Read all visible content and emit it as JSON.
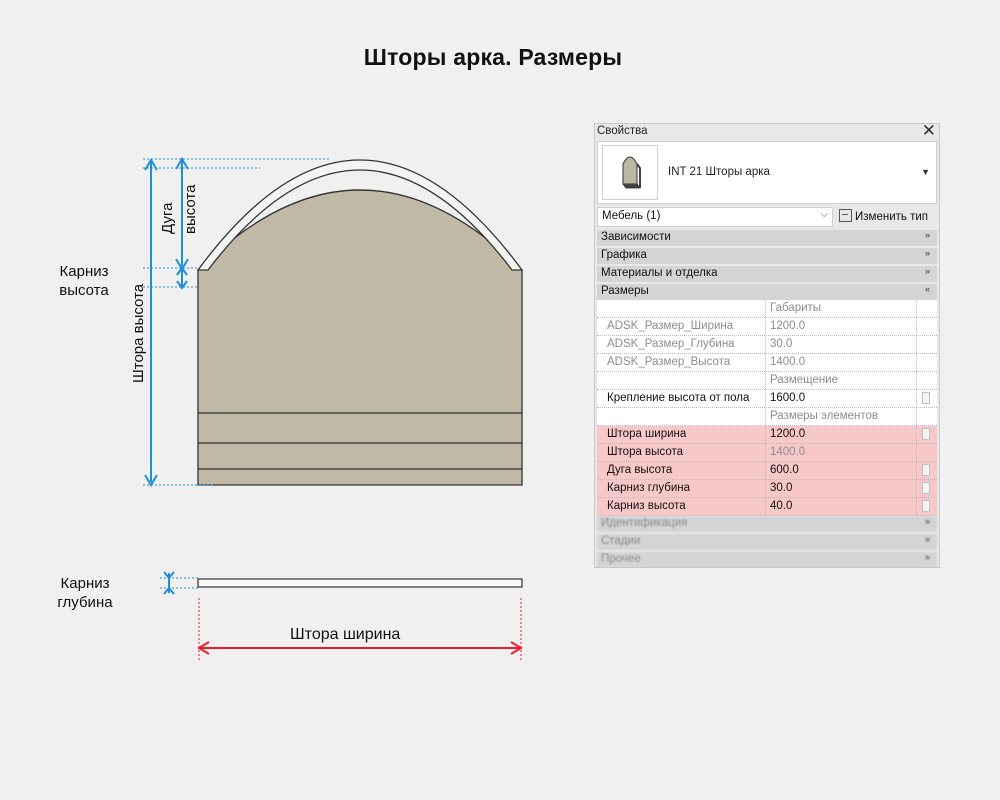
{
  "title": "Шторы арка. Размеры",
  "drawing": {
    "labels": {
      "karniz_vysota": "Карниз высота",
      "shtora_vysota": "Штора высота",
      "duga_vysota": "Дуга высота",
      "karniz_glubina": "Карниз глубина",
      "shtora_shirina": "Штора ширина"
    },
    "colors": {
      "curtain_fill": "#bfb9a6",
      "dimension_blue": "#1f8fd6",
      "dimension_red": "#e41e26",
      "outline": "#333333"
    }
  },
  "panel": {
    "title": "Свойства",
    "close_icon": "close-icon",
    "type_name": "INT 21 Шторы арка",
    "filter": "Мебель (1)",
    "edit_type": "Изменить тип",
    "categories": {
      "constraints": "Зависимости",
      "graphics": "Графика",
      "materials": "Материалы и отделка",
      "dimensions": "Размеры",
      "identity": "Идентификация",
      "phasing": "Стадии",
      "other": "Прочее"
    },
    "rows": [
      {
        "name": "",
        "value": "Габариты"
      },
      {
        "name": "ADSK_Размер_Ширина",
        "value": "1200.0"
      },
      {
        "name": "ADSK_Размер_Глубина",
        "value": "30.0"
      },
      {
        "name": "ADSK_Размер_Высота",
        "value": "1400.0"
      },
      {
        "name": "",
        "value": "Размещение"
      },
      {
        "name": "Крепление высота от пола",
        "value": "1600.0"
      },
      {
        "name": "",
        "value": "Размеры элементов"
      },
      {
        "name": "Штора ширина",
        "value": "1200.0"
      },
      {
        "name": "Штора высота",
        "value": "1400.0"
      },
      {
        "name": "Дуга высота",
        "value": "600.0"
      },
      {
        "name": "Карниз глубина",
        "value": "30.0"
      },
      {
        "name": "Карниз высота",
        "value": "40.0"
      }
    ],
    "highlight_color": "#f8c7c7"
  }
}
